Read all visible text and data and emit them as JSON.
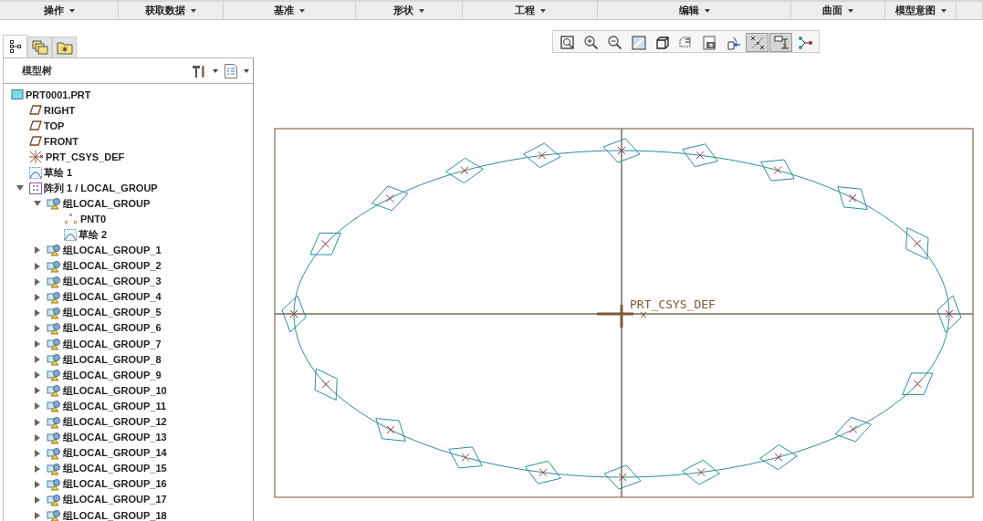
{
  "menu_bar": [
    {
      "label": "操作"
    },
    {
      "label": "获取数据"
    },
    {
      "label": "基准"
    },
    {
      "label": "形状"
    },
    {
      "label": "工程"
    },
    {
      "label": "编辑"
    },
    {
      "label": "曲面"
    },
    {
      "label": "模型意图"
    }
  ],
  "panel_tabs": [
    {
      "kind": "tree",
      "selected": true
    },
    {
      "kind": "layers",
      "selected": false
    },
    {
      "kind": "favorites",
      "selected": false
    }
  ],
  "model_tree": {
    "title": "模型树",
    "tree": [
      {
        "label": "PRT0001.PRT",
        "kind": "part",
        "children": [
          {
            "label": "RIGHT",
            "kind": "plane"
          },
          {
            "label": "TOP",
            "kind": "plane"
          },
          {
            "label": "FRONT",
            "kind": "plane"
          },
          {
            "label": "PRT_CSYS_DEF",
            "kind": "csys"
          },
          {
            "label": "草绘 1",
            "kind": "sketch"
          },
          {
            "label": "阵列 1 / LOCAL_GROUP",
            "kind": "pattern",
            "expanded": true,
            "children": [
              {
                "label": "组LOCAL_GROUP",
                "kind": "group",
                "expanded": true,
                "children": [
                  {
                    "label": "PNT0",
                    "kind": "point"
                  },
                  {
                    "label": "草绘 2",
                    "kind": "sketch"
                  }
                ]
              },
              {
                "label": "组LOCAL_GROUP_1",
                "kind": "group",
                "expanded": false
              },
              {
                "label": "组LOCAL_GROUP_2",
                "kind": "group",
                "expanded": false
              },
              {
                "label": "组LOCAL_GROUP_3",
                "kind": "group",
                "expanded": false
              },
              {
                "label": "组LOCAL_GROUP_4",
                "kind": "group",
                "expanded": false
              },
              {
                "label": "组LOCAL_GROUP_5",
                "kind": "group",
                "expanded": false
              },
              {
                "label": "组LOCAL_GROUP_6",
                "kind": "group",
                "expanded": false
              },
              {
                "label": "组LOCAL_GROUP_7",
                "kind": "group",
                "expanded": false
              },
              {
                "label": "组LOCAL_GROUP_8",
                "kind": "group",
                "expanded": false
              },
              {
                "label": "组LOCAL_GROUP_9",
                "kind": "group",
                "expanded": false
              },
              {
                "label": "组LOCAL_GROUP_10",
                "kind": "group",
                "expanded": false
              },
              {
                "label": "组LOCAL_GROUP_11",
                "kind": "group",
                "expanded": false
              },
              {
                "label": "组LOCAL_GROUP_12",
                "kind": "group",
                "expanded": false
              },
              {
                "label": "组LOCAL_GROUP_13",
                "kind": "group",
                "expanded": false
              },
              {
                "label": "组LOCAL_GROUP_14",
                "kind": "group",
                "expanded": false
              },
              {
                "label": "组LOCAL_GROUP_15",
                "kind": "group",
                "expanded": false
              },
              {
                "label": "组LOCAL_GROUP_16",
                "kind": "group",
                "expanded": false
              },
              {
                "label": "组LOCAL_GROUP_17",
                "kind": "group",
                "expanded": false
              },
              {
                "label": "组LOCAL_GROUP_18",
                "kind": "group",
                "expanded": false
              }
            ]
          }
        ]
      }
    ]
  },
  "view_toolbar": [
    {
      "kind": "zoom-fit",
      "on": false
    },
    {
      "kind": "zoom-in",
      "on": false
    },
    {
      "kind": "zoom-out",
      "on": false
    },
    {
      "kind": "repaint",
      "on": false
    },
    {
      "kind": "cube",
      "on": false
    },
    {
      "kind": "named-view",
      "on": false
    },
    {
      "kind": "camera",
      "on": false
    },
    {
      "kind": "orient",
      "on": false
    },
    {
      "kind": "point-display",
      "on": true
    },
    {
      "kind": "csys-display",
      "on": true
    },
    {
      "kind": "nodes",
      "on": false
    }
  ],
  "canvas": {
    "csys_label": "PRT_CSYS_DEF"
  }
}
